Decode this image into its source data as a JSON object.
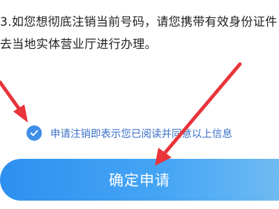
{
  "notice": {
    "line1": "3.如您想彻底注销当前号码，请您携带有效身份证件",
    "line2": "去当地实体营业厅进行办理。"
  },
  "agreement": {
    "checked": true,
    "text": "申请注销即表示您已阅读并同意以上信息"
  },
  "button": {
    "label": "确定申请"
  },
  "colors": {
    "accent": "#3f8ee8",
    "arrow": "#e8343a"
  }
}
